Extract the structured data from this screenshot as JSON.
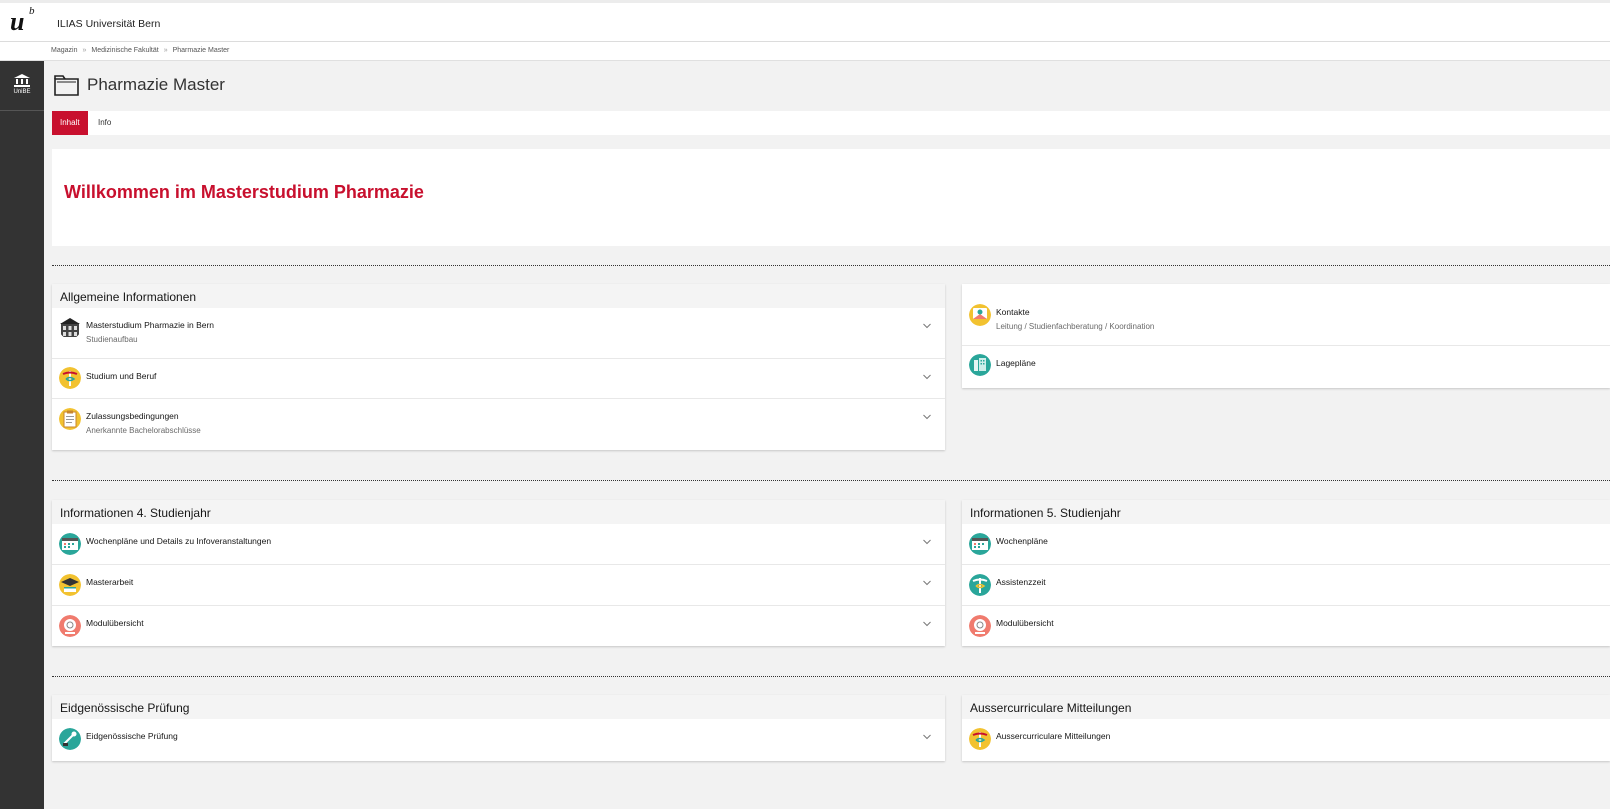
{
  "header": {
    "logo_text": "u",
    "logo_sup": "b",
    "site_title": "ILIAS Universität Bern"
  },
  "breadcrumb": [
    "Magazin",
    "Medizinische Fakultät",
    "Pharmazie Master"
  ],
  "sidebar": {
    "item_label": "UniBE"
  },
  "page": {
    "title": "Pharmazie Master",
    "tabs": [
      {
        "label": "Inhalt",
        "active": true
      },
      {
        "label": "Info",
        "active": false
      }
    ],
    "welcome": "Willkommen im Masterstudium Pharmazie"
  },
  "panels": {
    "allgemein": {
      "title": "Allgemeine Informationen",
      "items": [
        {
          "title": "Masterstudium Pharmazie in Bern",
          "subtitle": "Studienaufbau",
          "icon": "building-icon"
        },
        {
          "title": "Studium und Beruf",
          "subtitle": "",
          "icon": "caduceus-icon"
        },
        {
          "title": "Zulassungsbedingungen",
          "subtitle": "Anerkannte Bachelorabschlüsse",
          "icon": "clipboard-icon"
        }
      ]
    },
    "kontakte": {
      "items": [
        {
          "title": "Kontakte",
          "subtitle": "Leitung / Studienfachberatung / Koordination",
          "icon": "contact-icon"
        },
        {
          "title": "Lagepläne",
          "subtitle": "",
          "icon": "map-icon"
        }
      ]
    },
    "jahr4": {
      "title": "Informationen 4. Studienjahr",
      "items": [
        {
          "title": "Wochenpläne und Details zu Infoveranstaltungen",
          "icon": "calendar-icon"
        },
        {
          "title": "Masterarbeit",
          "icon": "graduation-icon"
        },
        {
          "title": "Modulübersicht",
          "icon": "module-icon"
        }
      ]
    },
    "jahr5": {
      "title": "Informationen 5. Studienjahr",
      "items": [
        {
          "title": "Wochenpläne",
          "icon": "calendar-icon"
        },
        {
          "title": "Assistenzzeit",
          "icon": "caduceus-icon"
        },
        {
          "title": "Modulübersicht",
          "icon": "module-icon"
        }
      ]
    },
    "pruefung": {
      "title": "Eidgenössische Prüfung",
      "items": [
        {
          "title": "Eidgenössische Prüfung",
          "icon": "exam-icon"
        }
      ]
    },
    "mitteilungen": {
      "title": "Aussercurriculare Mitteilungen",
      "items": [
        {
          "title": "Aussercurriculare Mitteilungen",
          "icon": "caduceus-icon"
        }
      ]
    }
  },
  "colors": {
    "accent": "#c8102e",
    "sidebar": "#333333",
    "teal": "#2aa69a",
    "yellow": "#f2c230",
    "salmon": "#f07b6e"
  }
}
